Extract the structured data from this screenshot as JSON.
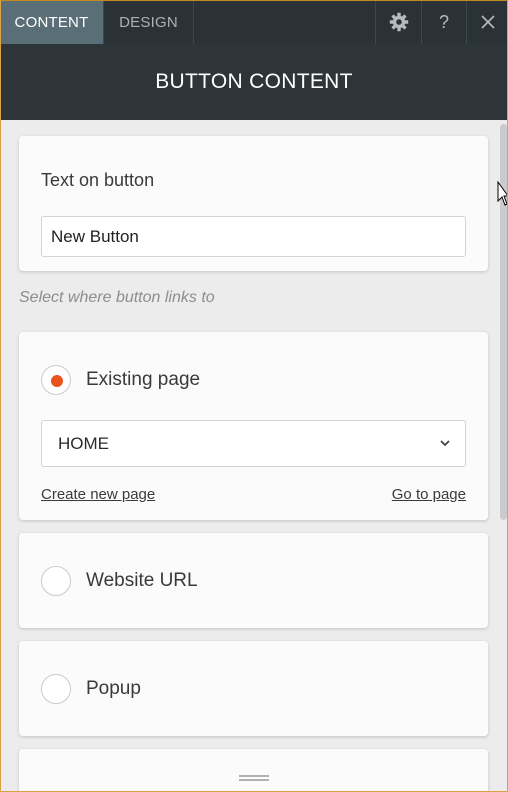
{
  "tabs": [
    {
      "label": "CONTENT",
      "active": true
    },
    {
      "label": "DESIGN",
      "active": false
    }
  ],
  "toolbar_icons": [
    "gear-icon",
    "help-icon",
    "close-icon"
  ],
  "help_glyph": "?",
  "panel": {
    "title": "BUTTON CONTENT"
  },
  "button_text": {
    "label": "Text on button",
    "value": "New Button"
  },
  "link_hint": "Select where button links to",
  "link_options": [
    {
      "label": "Existing page",
      "selected": true
    },
    {
      "label": "Website URL",
      "selected": false
    },
    {
      "label": "Popup",
      "selected": false
    }
  ],
  "existing_page": {
    "selected_page": "HOME",
    "create_link": "Create new page",
    "goto_link": "Go to page"
  },
  "colors": {
    "accent": "#e8541c",
    "topbar": "#2b3236",
    "active_tab": "#5a6e77",
    "header": "#2d3539"
  }
}
